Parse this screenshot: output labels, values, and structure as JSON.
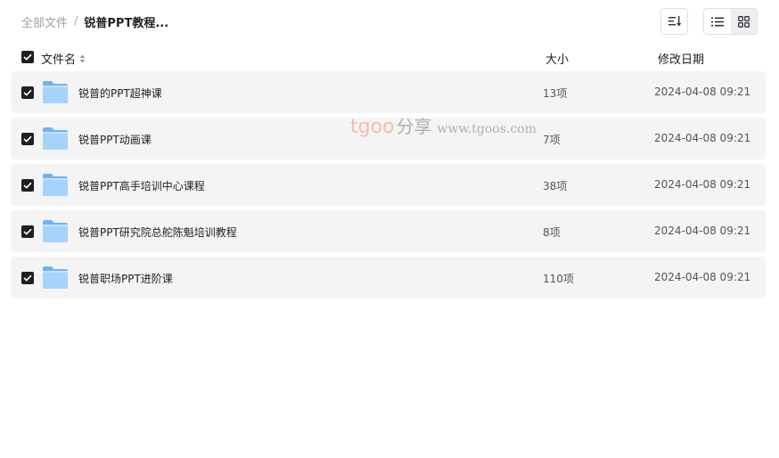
{
  "breadcrumb": {
    "root": "全部文件",
    "separator": "/",
    "current": "锐普PPT教程..."
  },
  "toolbar": {
    "sort_icon": "sort-icon",
    "list_view_icon": "list-view-icon",
    "grid_view_icon": "grid-view-icon",
    "active_view": "grid"
  },
  "columns": {
    "name": "文件名",
    "size": "大小",
    "modified": "修改日期"
  },
  "files": [
    {
      "name": "锐普的PPT超神课",
      "size": "13项",
      "modified": "2024-04-08 09:21",
      "checked": true
    },
    {
      "name": "锐普PPT动画课",
      "size": "7项",
      "modified": "2024-04-08 09:21",
      "checked": true
    },
    {
      "name": "锐普PPT高手培训中心课程",
      "size": "38项",
      "modified": "2024-04-08 09:21",
      "checked": true
    },
    {
      "name": "锐普PPT研究院总舵陈魁培训教程",
      "size": "8项",
      "modified": "2024-04-08 09:21",
      "checked": true
    },
    {
      "name": "锐普职场PPT进阶课",
      "size": "110项",
      "modified": "2024-04-08 09:21",
      "checked": true
    }
  ],
  "watermark": {
    "brand": "tgoo",
    "suffix": "分享",
    "url": "www.tgoos.com"
  },
  "colors": {
    "row_bg": "#f4f4f5",
    "checkbox": "#1f1f1f",
    "folder_light": "#a7d3fb",
    "folder_dark": "#6fb3f4"
  }
}
